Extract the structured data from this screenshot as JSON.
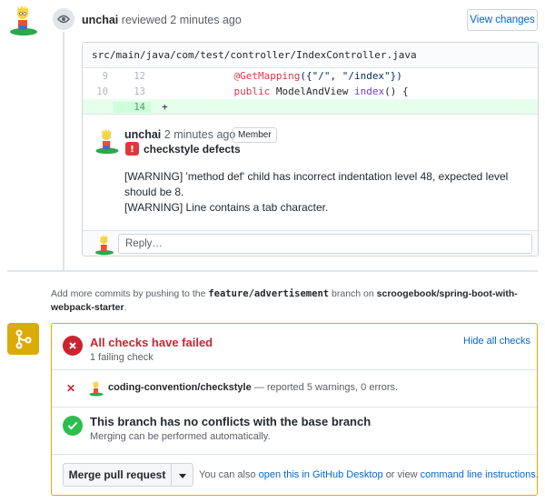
{
  "review": {
    "author": "unchai",
    "action": "reviewed",
    "time": "2 minutes ago",
    "view_changes_label": "View changes"
  },
  "diff": {
    "file_path": "src/main/java/com/test/controller/IndexController.java",
    "lines": [
      {
        "old": "9",
        "new": "12",
        "annotation": "@GetMapping",
        "args": "({\"/\", \"/index\"})"
      },
      {
        "old": "10",
        "new": "13",
        "keyword": "public",
        "type": "ModelAndView",
        "method": "index",
        "rest": "() {"
      },
      {
        "old": "",
        "new": "14",
        "text": "+"
      }
    ]
  },
  "comment": {
    "author": "unchai",
    "time": "2 minutes ago",
    "badge": "Member",
    "title": "checkstyle defects",
    "body_line1": "[WARNING] 'method def' child has incorrect indentation level 48, expected level should be 8.",
    "body_line2": "[WARNING] Line contains a tab character.",
    "reply_placeholder": "Reply…"
  },
  "hint": {
    "prefix": "Add more commits by pushing to the",
    "branch": "feature/advertisement",
    "middle": "branch on",
    "repo": "scroogebook/spring-boot-with-webpack-starter",
    "suffix": "."
  },
  "checks": {
    "title": "All checks have failed",
    "subtitle": "1 failing check",
    "hide_label": "Hide all checks",
    "items": [
      {
        "name": "coding-convention/checkstyle",
        "status": "— reported 5 warnings, 0 errors."
      }
    ]
  },
  "conflicts": {
    "title": "This branch has no conflicts with the base branch",
    "subtitle": "Merging can be performed automatically."
  },
  "merge": {
    "button_label": "Merge pull request",
    "alt_prefix": "You can also",
    "desktop_link": "open this in GitHub Desktop",
    "alt_middle": "or view",
    "cli_link": "command line instructions",
    "alt_suffix": "."
  },
  "colors": {
    "failed": "#cb2431",
    "success": "#2cbe4e",
    "warning_border": "#dbab09",
    "link": "#0366d6",
    "added_line_bg": "#e6ffed"
  }
}
